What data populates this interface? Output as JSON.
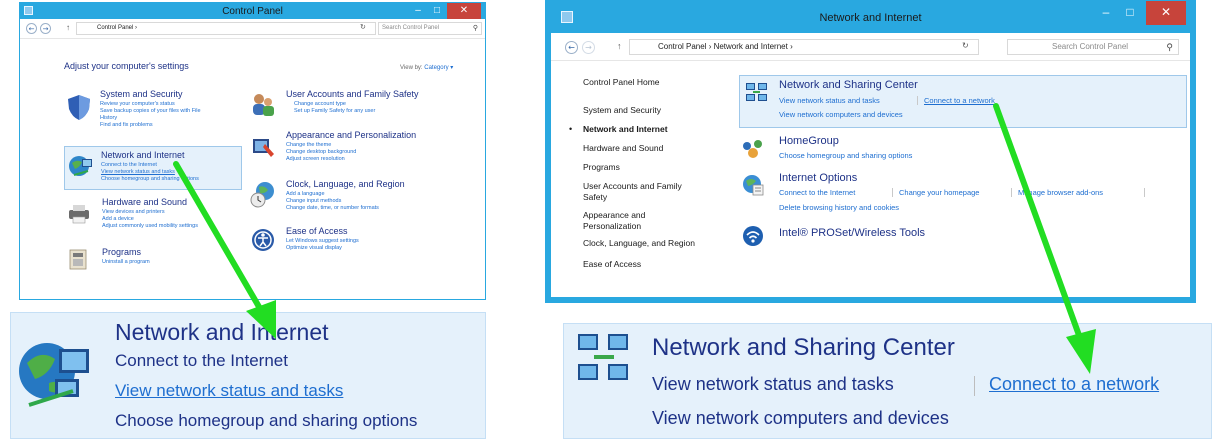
{
  "left_window": {
    "title": "Control Panel",
    "address": "Control Panel  ›",
    "search_placeholder": "Search Control Panel",
    "heading": "Adjust your computer's settings",
    "view_by_label": "View by:",
    "view_by_value": "Category ▾",
    "categories": [
      {
        "title": "System and Security",
        "links": [
          "Review your computer's status",
          "Save backup copies of your files with File",
          "History",
          "Find and fix problems"
        ]
      },
      {
        "title": "Network and Internet",
        "links": [
          "Connect to the Internet",
          "View network status and tasks",
          "Choose homegroup and sharing options"
        ]
      },
      {
        "title": "Hardware and Sound",
        "links": [
          "View devices and printers",
          "Add a device",
          "Adjust commonly used mobility settings"
        ]
      },
      {
        "title": "Programs",
        "links": [
          "Uninstall a program"
        ]
      },
      {
        "title": "User Accounts and Family Safety",
        "links": [
          "Change account type",
          "Set up Family Safety for any user"
        ]
      },
      {
        "title": "Appearance and Personalization",
        "links": [
          "Change the theme",
          "Change desktop background",
          "Adjust screen resolution"
        ]
      },
      {
        "title": "Clock, Language, and Region",
        "links": [
          "Add a language",
          "Change input methods",
          "Change date, time, or number formats"
        ]
      },
      {
        "title": "Ease of Access",
        "links": [
          "Let Windows suggest settings",
          "Optimize visual display"
        ]
      }
    ]
  },
  "right_window": {
    "title": "Network and Internet",
    "address": "Control Panel  ›  Network and Internet  ›",
    "search_placeholder": "Search Control Panel",
    "nav": [
      "Control Panel Home",
      "System and Security",
      "Network and Internet",
      "Hardware and Sound",
      "Programs",
      "User Accounts and Family",
      "Safety",
      "Appearance and",
      "Personalization",
      "Clock, Language, and Region",
      "Ease of Access"
    ],
    "sections": [
      {
        "title": "Network and Sharing Center",
        "links": [
          "View network status and tasks",
          "Connect to a network",
          "View network computers and devices"
        ]
      },
      {
        "title": "HomeGroup",
        "links": [
          "Choose homegroup and sharing options"
        ]
      },
      {
        "title": "Internet Options",
        "links": [
          "Connect to the Internet",
          "Change your homepage",
          "Manage browser add-ons",
          "Delete browsing history and cookies"
        ]
      },
      {
        "title": "Intel® PROSet/Wireless Tools",
        "links": []
      }
    ]
  },
  "zoom_left": {
    "title": "Network and Internet",
    "links": [
      "Connect to the Internet",
      "View network status and tasks",
      "Choose homegroup and sharing options"
    ]
  },
  "zoom_right": {
    "title": "Network and Sharing Center",
    "links": [
      "View network status and tasks",
      "Connect to a network",
      "View network computers and devices"
    ]
  },
  "colors": {
    "titlebar": "#29a8e0",
    "close": "#c7443b",
    "link": "#1e6ed0",
    "heading": "#1e3287",
    "highlight": "#e5f1fb",
    "arrow": "#22dd22"
  },
  "icons": [
    "control-panel-icon",
    "back-arrow-icon",
    "forward-arrow-icon",
    "up-arrow-icon",
    "refresh-icon",
    "search-icon",
    "minimize-icon",
    "maximize-icon",
    "close-icon",
    "shield-icon",
    "globe-network-icon",
    "printer-icon",
    "programs-icon",
    "users-icon",
    "paint-icon",
    "clock-globe-icon",
    "ease-of-access-icon",
    "network-center-icon",
    "homegroup-icon",
    "internet-options-icon",
    "wireless-icon"
  ]
}
